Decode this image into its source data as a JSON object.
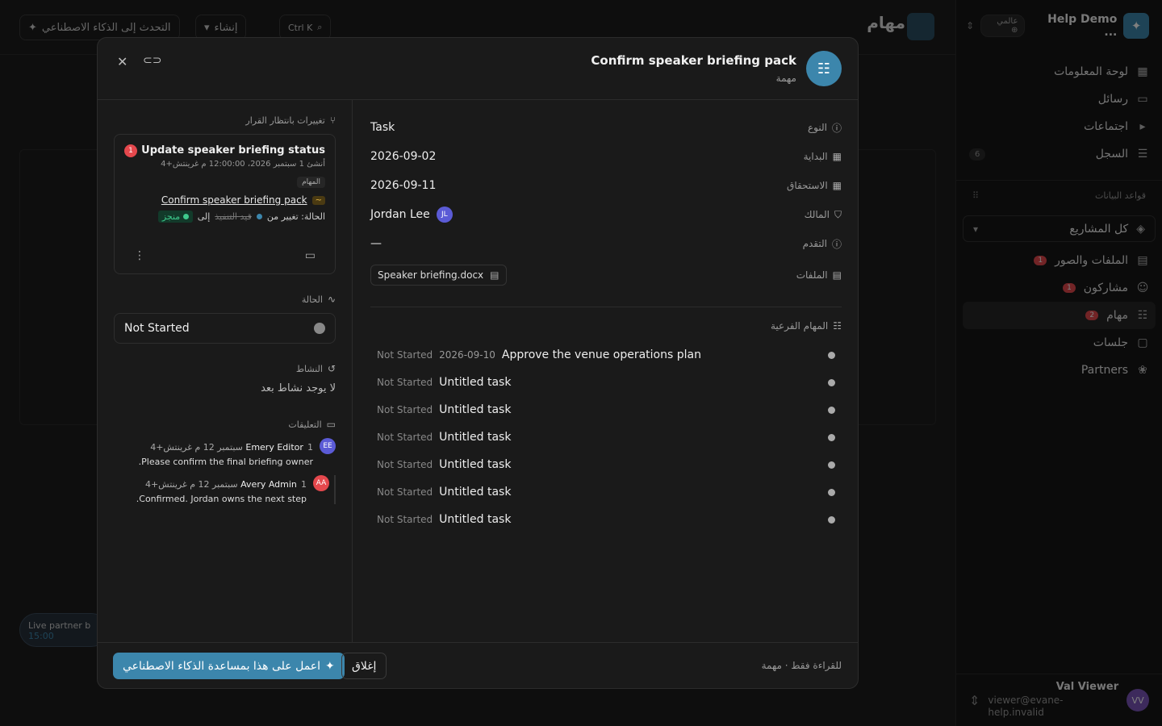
{
  "workspace": {
    "name": "Help Demo ...",
    "badge": "عالمي"
  },
  "sidebar": {
    "items": [
      {
        "label": "لوحة المعلومات",
        "icon": "dashboard-icon"
      },
      {
        "label": "رسائل",
        "icon": "message-icon"
      },
      {
        "label": "اجتماعات",
        "icon": "video-icon"
      },
      {
        "label": "السجل",
        "icon": "log-icon",
        "count": "6"
      }
    ],
    "databases_title": "قواعد البيانات",
    "projects_select": "كل المشاريع",
    "db_items": [
      {
        "label": "الملفات والصور",
        "icon": "file-icon",
        "badge": "1"
      },
      {
        "label": "مشاركون",
        "icon": "users-icon",
        "badge": "1"
      },
      {
        "label": "مهام",
        "icon": "tasks-icon",
        "badge": "2"
      },
      {
        "label": "جلسات",
        "icon": "presentation-icon"
      },
      {
        "label": "Partners",
        "icon": "partners-icon"
      }
    ]
  },
  "user": {
    "name": "Val Viewer",
    "email": "viewer@evane-help.invalid",
    "initials": "VV"
  },
  "background": {
    "page_title": "مهام",
    "ai_chat": "التحدث إلى الذكاء الاصطناعي",
    "create": "إنشاء",
    "shortcut": "Ctrl K",
    "pill_title": "Live partner b",
    "pill_time": "15:00"
  },
  "modal": {
    "title": "Confirm speaker briefing pack",
    "subtitle": "مهمة",
    "pending_title": "تغييرات بانتظار القرار",
    "change": {
      "title": "Update speaker briefing status",
      "meta": "أنشئ 1 سبتمبر 2026، 12:00:00 م غرينتش+4",
      "tag": "المهام",
      "link": "Confirm speaker briefing pack",
      "badge": "1",
      "status_prefix": "الحالة: تغيير من",
      "old_status": "قيد التنفيذ",
      "to": "إلى",
      "new_status": "منجز"
    },
    "status_title": "الحالة",
    "status_value": "Not Started",
    "activity_title": "النشاط",
    "activity_empty": "لا يوجد نشاط بعد",
    "comments_title": "التعليقات",
    "comments": [
      {
        "initials": "EE",
        "name": "Emery Editor",
        "date": "1 سبتمبر 12 م غرينتش+4",
        "text": "Please confirm the final briefing owner.",
        "color": "#5b5bd6"
      },
      {
        "initials": "AA",
        "name": "Avery Admin",
        "date": "1 سبتمبر 12 م غرينتش+4",
        "text": "Confirmed. Jordan owns the next step.",
        "color": "#e5484d"
      }
    ],
    "props": [
      {
        "label": "النوع",
        "value": "Task",
        "icon": "info-icon"
      },
      {
        "label": "البداية",
        "value": "2026-09-02",
        "icon": "calendar-icon"
      },
      {
        "label": "الاستحقاق",
        "value": "2026-09-11",
        "icon": "calendar-icon"
      },
      {
        "label": "المالك",
        "value": "Jordan Lee",
        "icon": "shield-icon",
        "initials": "JL"
      },
      {
        "label": "التقدم",
        "value": "—",
        "icon": "info-icon"
      },
      {
        "label": "الملفات",
        "value": "Speaker briefing.docx",
        "icon": "file-icon"
      }
    ],
    "subtasks_title": "المهام الفرعية",
    "subtasks": [
      {
        "status": "Not Started",
        "date": "2026-09-10",
        "title": "Approve the venue operations plan"
      },
      {
        "status": "Not Started",
        "date": "",
        "title": "Untitled task"
      },
      {
        "status": "Not Started",
        "date": "",
        "title": "Untitled task"
      },
      {
        "status": "Not Started",
        "date": "",
        "title": "Untitled task"
      },
      {
        "status": "Not Started",
        "date": "",
        "title": "Untitled task"
      },
      {
        "status": "Not Started",
        "date": "",
        "title": "Untitled task"
      },
      {
        "status": "Not Started",
        "date": "",
        "title": "Untitled task"
      }
    ],
    "footer": {
      "ai_button": "اعمل على هذا بمساعدة الذكاء الاصطناعي",
      "close_button": "إغلاق",
      "readonly": "للقراءة فقط · مهمة"
    }
  }
}
